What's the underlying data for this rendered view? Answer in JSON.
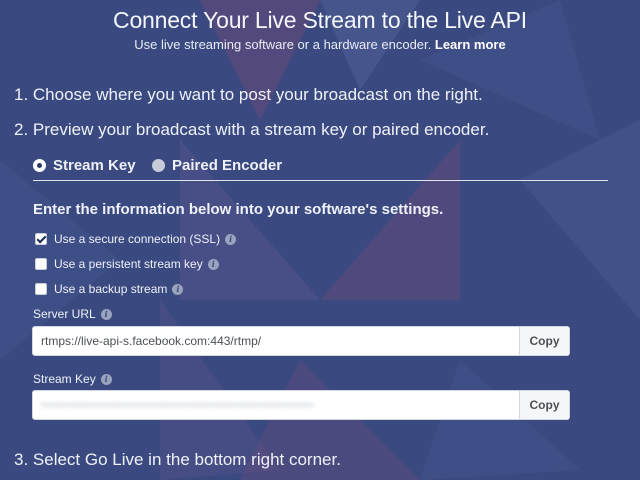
{
  "header": {
    "title": "Connect Your Live Stream to the Live API",
    "subtitle": "Use live streaming software or a hardware encoder.",
    "learn_more": "Learn more"
  },
  "steps": {
    "step1": "1. Choose where you want to post your broadcast on the right.",
    "step2": "2. Preview your broadcast with a stream key or paired encoder.",
    "step3": "3. Select Go Live in the bottom right corner."
  },
  "tabs": {
    "stream_key": {
      "label": "Stream Key",
      "selected": true
    },
    "paired_encoder": {
      "label": "Paired Encoder",
      "selected": false
    }
  },
  "settings": {
    "heading": "Enter the information below into your software's settings.",
    "options": [
      {
        "label": "Use a secure connection (SSL)",
        "checked": true
      },
      {
        "label": "Use a persistent stream key",
        "checked": false
      },
      {
        "label": "Use a backup stream",
        "checked": false
      }
    ]
  },
  "server_url": {
    "label": "Server URL",
    "value": "rtmps://live-api-s.facebook.com:443/rtmp/",
    "copy_label": "Copy"
  },
  "stream_key": {
    "label": "Stream Key",
    "value": "••••••••••••••••••••••••••••••••••••••••••••••••••••••••••",
    "copy_label": "Copy"
  },
  "icons": {
    "info": "info-icon",
    "checkbox_checked": "checkmark-icon",
    "radio_selected": "radio-selected-icon",
    "radio_unselected": "radio-unselected-icon"
  },
  "colors": {
    "background": "#3a4b82",
    "text": "#eef1f8",
    "field_background": "#ffffff",
    "copy_button": "#f5f6f7"
  }
}
